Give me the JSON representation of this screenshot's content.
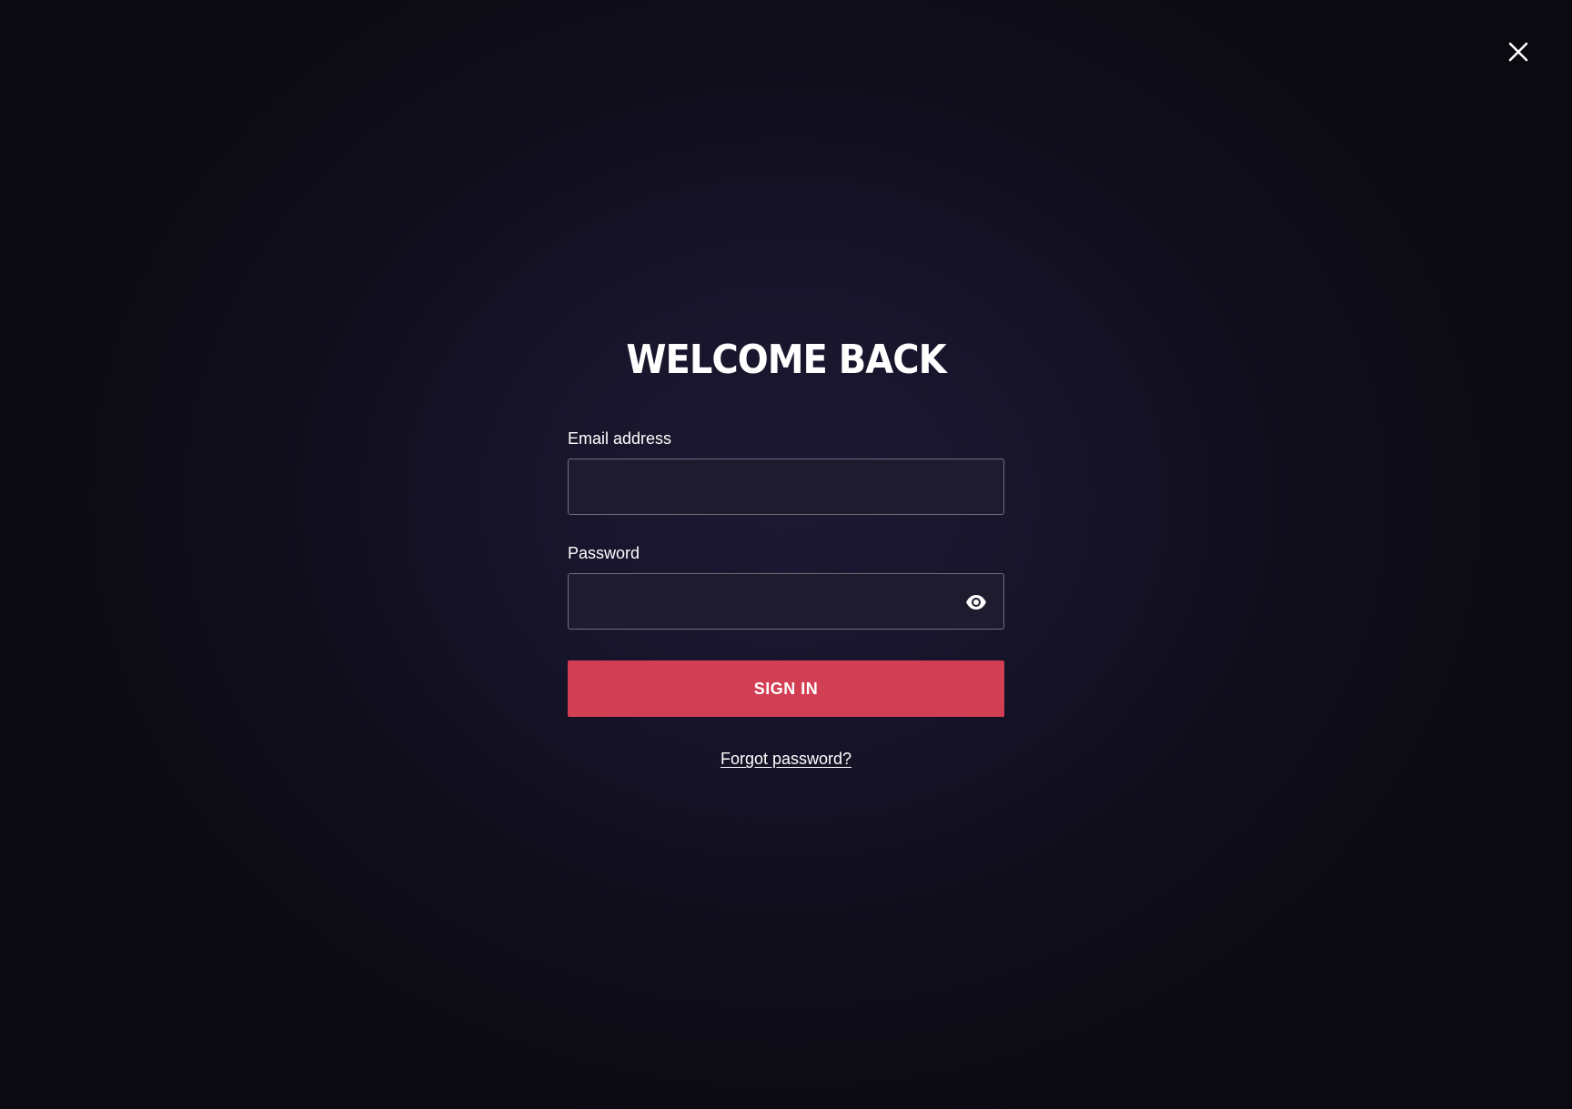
{
  "modal": {
    "close_icon": "close-icon",
    "title": "WELCOME BACK"
  },
  "form": {
    "email": {
      "label": "Email address",
      "value": "",
      "placeholder": ""
    },
    "password": {
      "label": "Password",
      "value": "",
      "placeholder": "",
      "toggle_icon": "eye-icon"
    },
    "submit_label": "SIGN IN",
    "forgot_label": "Forgot password?"
  },
  "colors": {
    "accent": "#d23f54",
    "background": "#17142a",
    "field_border": "#6f6c80"
  }
}
